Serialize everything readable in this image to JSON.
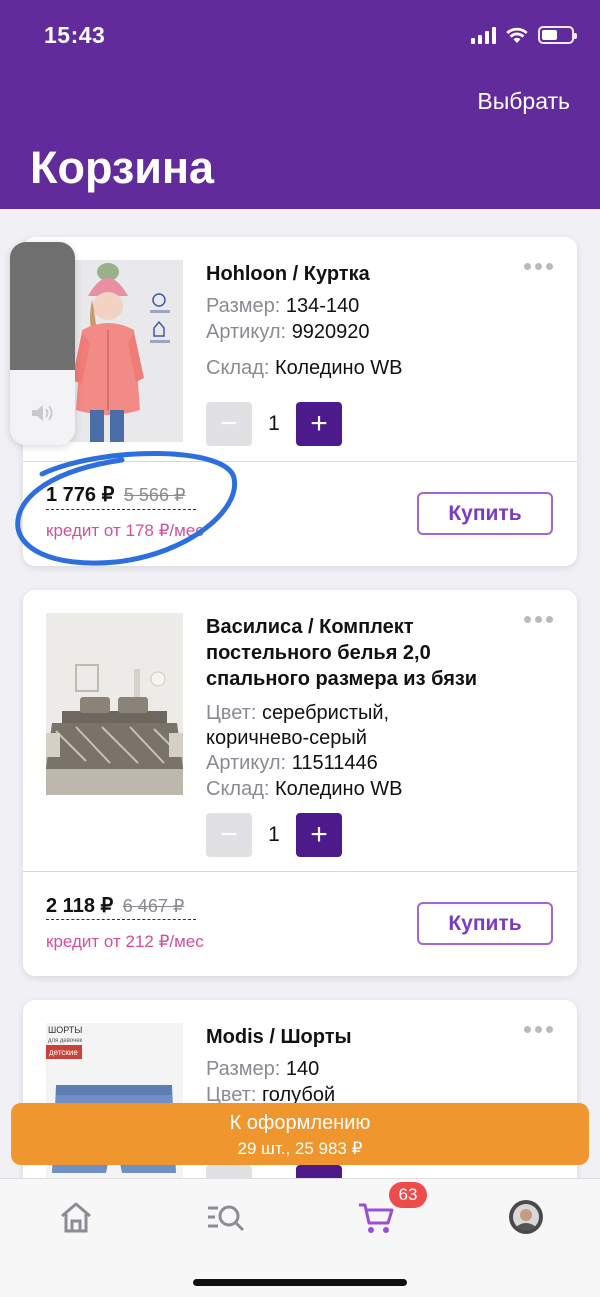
{
  "status_bar": {
    "time": "15:43"
  },
  "header": {
    "select_label": "Выбрать",
    "title": "Корзина"
  },
  "items": [
    {
      "name": "Hohloon / Куртка",
      "attributes": [
        {
          "key": "Размер:",
          "value": "134-140"
        },
        {
          "key": "Артикул:",
          "value": "9920920"
        },
        {
          "key": "Склад:",
          "value": "Коледино WB"
        }
      ],
      "quantity": "1",
      "price": "1 776 ₽",
      "old_price": "5 566 ₽",
      "credit": "кредит от 178 ₽/мес",
      "buy_label": "Купить"
    },
    {
      "name_lines": [
        "Василиса / Комплект",
        "постельного белья 2,0",
        "спального размера из бязи"
      ],
      "attributes": [
        {
          "key": "Цвет:",
          "value": "серебристый,"
        },
        {
          "key": "",
          "value": "коричнево-серый"
        },
        {
          "key": "Артикул:",
          "value": "11511446"
        },
        {
          "key": "Склад:",
          "value": "Коледино WB"
        }
      ],
      "quantity": "1",
      "price": "2 118 ₽",
      "old_price": "6 467 ₽",
      "credit": "кредит от 212 ₽/мес",
      "buy_label": "Купить"
    },
    {
      "name": "Modis / Шорты",
      "attributes": [
        {
          "key": "Размер:",
          "value": "140"
        },
        {
          "key": "Цвет:",
          "value": "голубой"
        }
      ],
      "thumb_text": [
        "ШОРТЫ",
        "для девочек",
        "детские"
      ]
    }
  ],
  "checkout": {
    "title": "К оформлению",
    "summary": "29 шт., 25 983 ₽"
  },
  "tabbar": {
    "cart_badge": "63"
  },
  "colors": {
    "brand": "#612b9b",
    "accent": "#f0962f",
    "credit": "#d0509a",
    "badge": "#f04b4b"
  },
  "icons": [
    "home-icon",
    "search-catalog-icon",
    "cart-icon",
    "profile-avatar-icon",
    "speaker-icon",
    "more-dots-icon"
  ]
}
